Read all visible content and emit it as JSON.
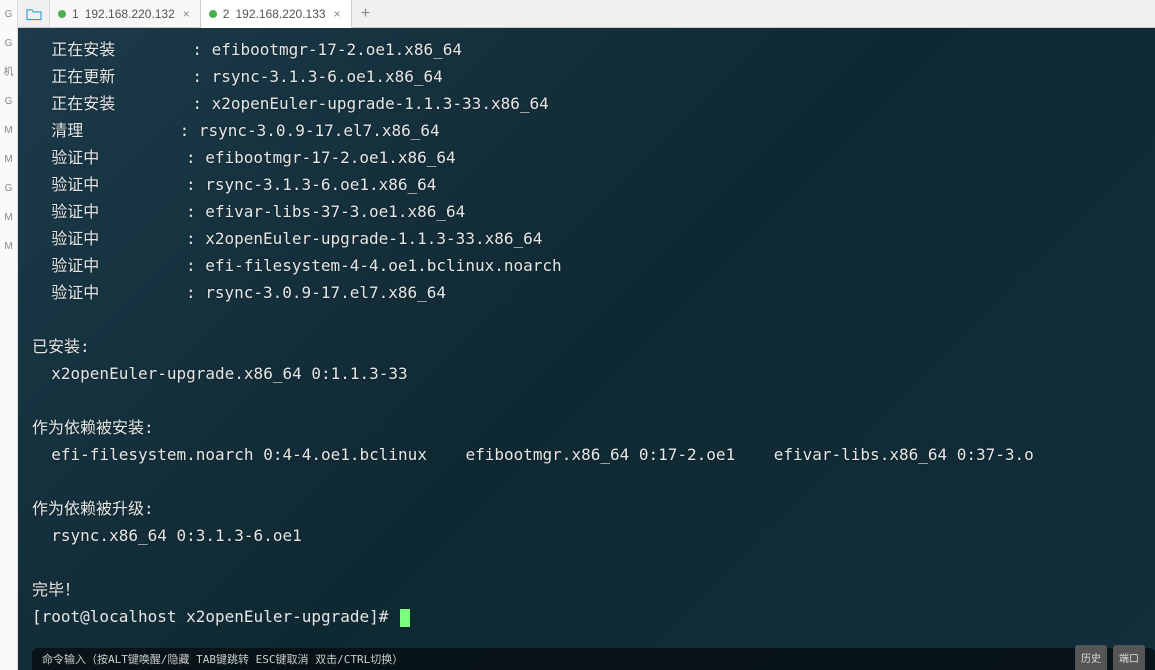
{
  "leftGutter": [
    "",
    "",
    "",
    "",
    "",
    "G",
    "G",
    "",
    "",
    "",
    "",
    "",
    "机",
    "",
    "",
    "",
    "G",
    "M",
    "M",
    "",
    "G",
    "M",
    "M"
  ],
  "tabs": [
    {
      "index": "1",
      "title": "192.168.220.132",
      "active": false
    },
    {
      "index": "2",
      "title": "192.168.220.133",
      "active": true
    }
  ],
  "addTab": "+",
  "terminal": {
    "transactionLines": [
      {
        "label": "  正在安装",
        "pkg": "efibootmgr-17-2.oe1.x86_64"
      },
      {
        "label": "  正在更新",
        "pkg": "rsync-3.1.3-6.oe1.x86_64"
      },
      {
        "label": "  正在安装",
        "pkg": "x2openEuler-upgrade-1.1.3-33.x86_64"
      },
      {
        "label": "  清理",
        "pkg": "rsync-3.0.9-17.el7.x86_64"
      },
      {
        "label": "  验证中",
        "pkg": "efibootmgr-17-2.oe1.x86_64"
      },
      {
        "label": "  验证中",
        "pkg": "rsync-3.1.3-6.oe1.x86_64"
      },
      {
        "label": "  验证中",
        "pkg": "efivar-libs-37-3.oe1.x86_64"
      },
      {
        "label": "  验证中",
        "pkg": "x2openEuler-upgrade-1.1.3-33.x86_64"
      },
      {
        "label": "  验证中",
        "pkg": "efi-filesystem-4-4.oe1.bclinux.noarch"
      },
      {
        "label": "  验证中",
        "pkg": "rsync-3.0.9-17.el7.x86_64"
      }
    ],
    "sections": [
      {
        "header": "已安装:",
        "lines": [
          "  x2openEuler-upgrade.x86_64 0:1.1.3-33"
        ]
      },
      {
        "header": "作为依赖被安装:",
        "lines": [
          "  efi-filesystem.noarch 0:4-4.oe1.bclinux    efibootmgr.x86_64 0:17-2.oe1    efivar-libs.x86_64 0:37-3.o"
        ]
      },
      {
        "header": "作为依赖被升级:",
        "lines": [
          "  rsync.x86_64 0:3.1.3-6.oe1"
        ]
      }
    ],
    "complete": "完毕！",
    "prompt": "[root@localhost x2openEuler-upgrade]# ",
    "hint": "命令输入（按ALT键唤醒/隐藏 TAB键跳转 ESC键取消 双击/CTRL切换）"
  },
  "bottomButtons": [
    "历史",
    "端口"
  ]
}
